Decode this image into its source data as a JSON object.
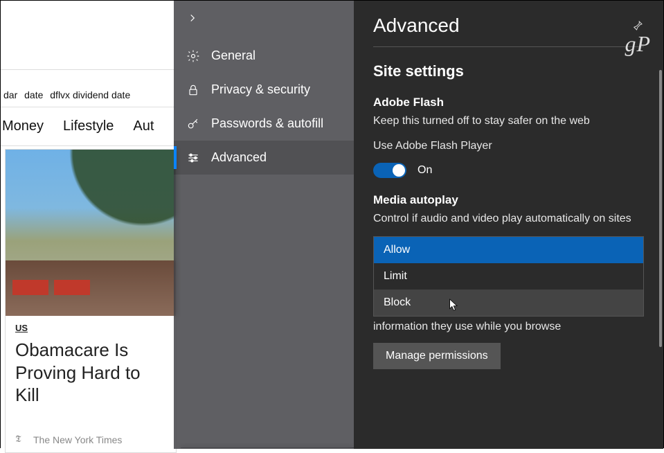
{
  "browser": {
    "url_fragments": [
      "dar",
      "date",
      "dflvx dividend date"
    ],
    "tabs": [
      "Money",
      "Lifestyle",
      "Aut"
    ],
    "article": {
      "category": "US",
      "headline": "Obamacare Is Proving Hard to Kill",
      "source": "The New York Times"
    }
  },
  "nav": {
    "items": [
      {
        "icon": "gear",
        "label": "General"
      },
      {
        "icon": "lock",
        "label": "Privacy & security"
      },
      {
        "icon": "key",
        "label": "Passwords & autofill"
      },
      {
        "icon": "sliders",
        "label": "Advanced"
      }
    ]
  },
  "pane": {
    "title": "Advanced",
    "watermark": "gP",
    "section": "Site settings",
    "flash": {
      "title": "Adobe Flash",
      "desc": "Keep this turned off to stay safer on the web",
      "toggle_label": "Use Adobe Flash Player",
      "toggle_state": "On"
    },
    "autoplay": {
      "title": "Media autoplay",
      "desc": "Control if audio and video play automatically on sites",
      "options": [
        "Allow",
        "Limit",
        "Block"
      ],
      "footer_text": "information they use while you browse",
      "button": "Manage permissions"
    }
  }
}
